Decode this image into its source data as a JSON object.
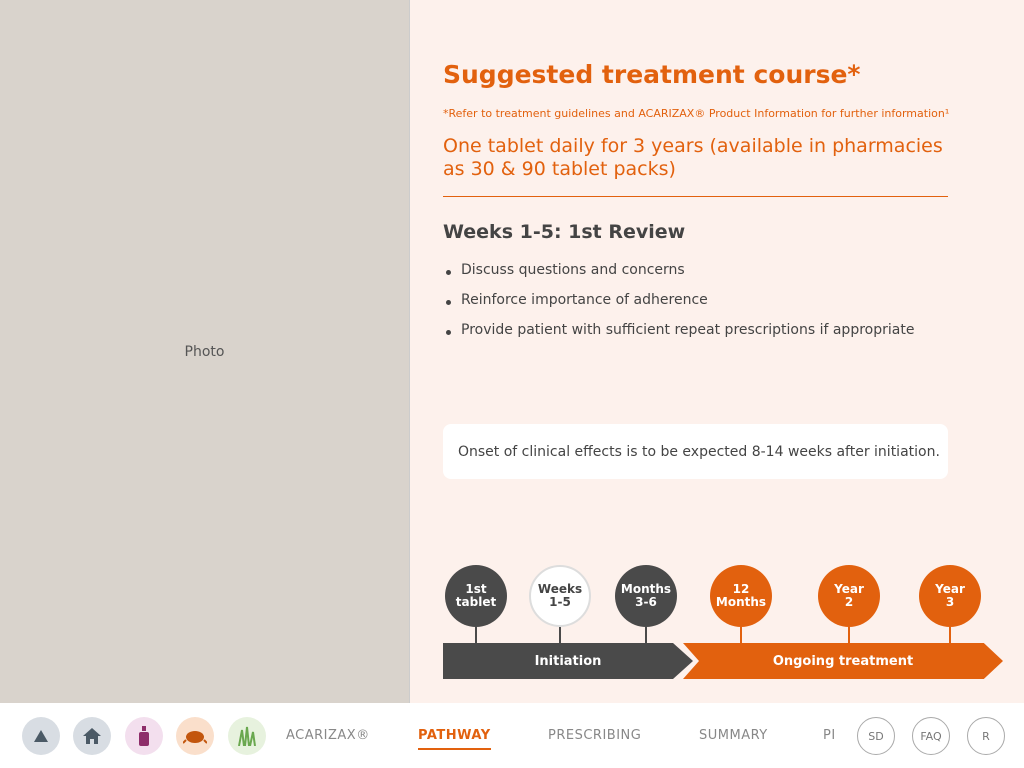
{
  "photo": {
    "label": "Photo"
  },
  "main": {
    "title": "Suggested treatment course*",
    "reference": "*Refer to treatment guidelines and ACARIZAX® Product Information for further information¹",
    "dose_text": "One tablet daily for 3 years (available in pharmacies as 30 & 90 tablet packs)",
    "week_title": "Weeks 1-5: 1st Review",
    "bullets": [
      "Discuss questions and concerns",
      "Reinforce importance of adherence",
      "Provide patient with sufficient repeat prescriptions if appropriate"
    ],
    "note": "Onset of clinical effects is to be expected 8-14 weeks after initiation."
  },
  "timeline": {
    "nodes": [
      {
        "line1": "1st",
        "line2": "tablet",
        "style": "dark"
      },
      {
        "line1": "Weeks",
        "line2": "1-5",
        "style": "light"
      },
      {
        "line1": "Months",
        "line2": "3-6",
        "style": "dark"
      },
      {
        "line1": "12",
        "line2": "Months",
        "style": "orange"
      },
      {
        "line1": "Year",
        "line2": "2",
        "style": "orange"
      },
      {
        "line1": "Year",
        "line2": "3",
        "style": "orange"
      }
    ],
    "initiation_label": "Initiation",
    "ongoing_label": "Ongoing treatment"
  },
  "nav": {
    "icons": [
      {
        "name": "triangle-up-icon",
        "bg": "#d8dde3"
      },
      {
        "name": "home-icon",
        "bg": "#d8dde3"
      },
      {
        "name": "perfume-bottle-icon",
        "bg": "#f3dfee"
      },
      {
        "name": "dust-mite-icon",
        "bg": "#fadfcb"
      },
      {
        "name": "grass-icon",
        "bg": "#e7f2de"
      }
    ],
    "links": [
      "ACARIZAX®",
      "PATHWAY",
      "PRESCRIBING",
      "SUMMARY",
      "PI"
    ],
    "active": "PATHWAY",
    "circle_buttons": [
      "SD",
      "FAQ",
      "R"
    ]
  },
  "colors": {
    "accent": "#e2610e",
    "dark": "#4a4a4a",
    "background": "#fdf1ec"
  }
}
